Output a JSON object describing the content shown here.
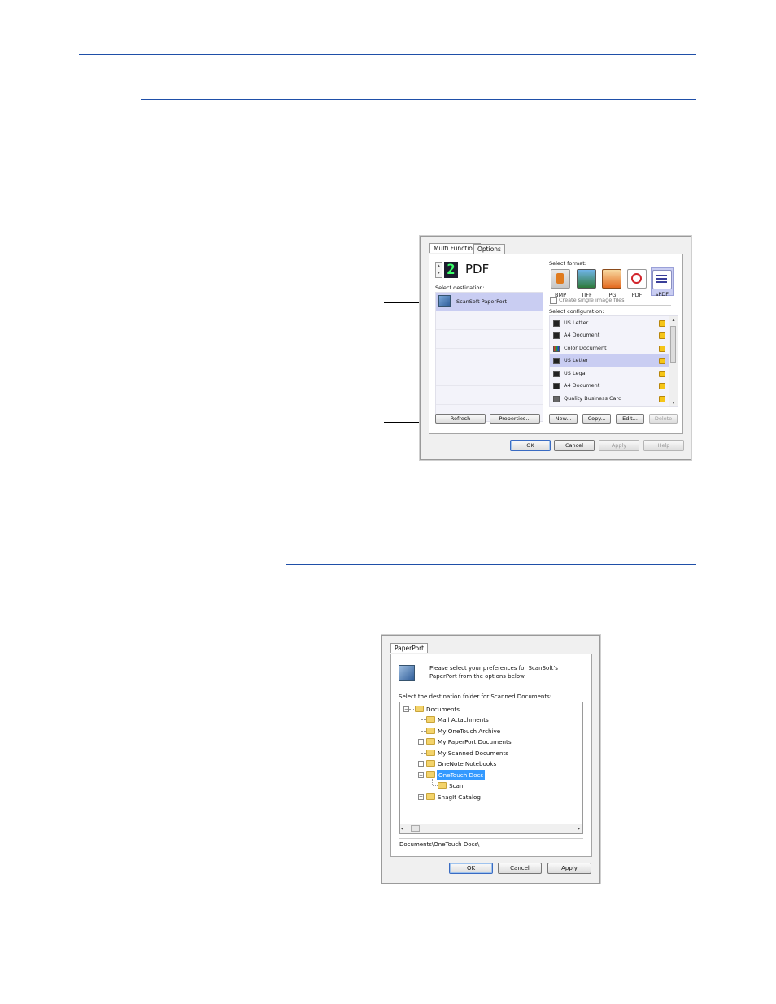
{
  "win1": {
    "tabs": [
      "Multi Function",
      "Options"
    ],
    "selector_digit": "2",
    "selector_label": "PDF",
    "select_destination_label": "Select destination:",
    "destinations": [
      "ScanSoft PaperPort"
    ],
    "select_format_label": "Select format:",
    "formats": [
      "BMP",
      "TIFF",
      "JPG",
      "PDF",
      "sPDF"
    ],
    "create_single_label": "Create single image files",
    "select_configuration_label": "Select configuration:",
    "configurations": [
      "US Letter",
      "A4 Document",
      "Color Document",
      "US Letter",
      "US Legal",
      "A4 Document",
      "Quality Business Card"
    ],
    "buttons": {
      "refresh": "Refresh",
      "properties": "Properties...",
      "new": "New...",
      "copy": "Copy...",
      "edit": "Edit...",
      "delete": "Delete",
      "ok": "OK",
      "cancel": "Cancel",
      "apply": "Apply",
      "help": "Help"
    }
  },
  "win2": {
    "tab": "PaperPort",
    "intro": [
      "Please select your preferences for ScanSoft's",
      "PaperPort from the options below."
    ],
    "folder_label": "Select the destination folder for Scanned Documents:",
    "tree": [
      {
        "label": "Documents"
      },
      {
        "label": "Mail Attachments"
      },
      {
        "label": "My OneTouch Archive"
      },
      {
        "label": "My PaperPort Documents"
      },
      {
        "label": "My Scanned Documents"
      },
      {
        "label": "OneNote Notebooks"
      },
      {
        "label": "OneTouch Docs"
      },
      {
        "label": "Scan"
      },
      {
        "label": "SnagIt Catalog"
      }
    ],
    "path": "Documents\\OneTouch Docs\\",
    "buttons": {
      "ok": "OK",
      "cancel": "Cancel",
      "apply": "Apply"
    }
  },
  "colors": {
    "rule": "#1f4fa8",
    "selection": "#c9cdf2",
    "tree_selection": "#3399ff"
  }
}
